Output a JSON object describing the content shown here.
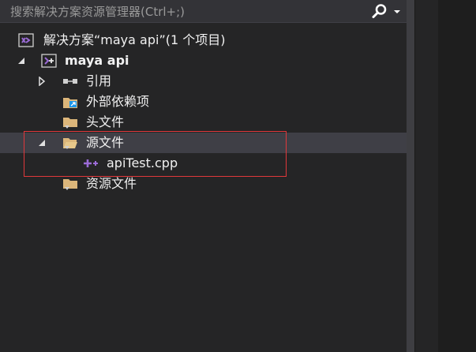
{
  "search": {
    "placeholder": "搜索解决方案资源管理器(Ctrl+;)"
  },
  "tree": {
    "solution": {
      "label": "解决方案“maya api”(1 个项目)"
    },
    "project": {
      "label": "maya api"
    },
    "items": [
      {
        "label": "引用"
      },
      {
        "label": "外部依赖项"
      },
      {
        "label": "头文件"
      },
      {
        "label": "源文件"
      },
      {
        "label": "apiTest.cpp"
      },
      {
        "label": "资源文件"
      }
    ]
  },
  "colors": {
    "background": "#252526",
    "selection": "#3f3f46",
    "highlight_box": "#e0383b",
    "folder": "#dcb67a",
    "vs_purple": "#9b6bd6"
  }
}
